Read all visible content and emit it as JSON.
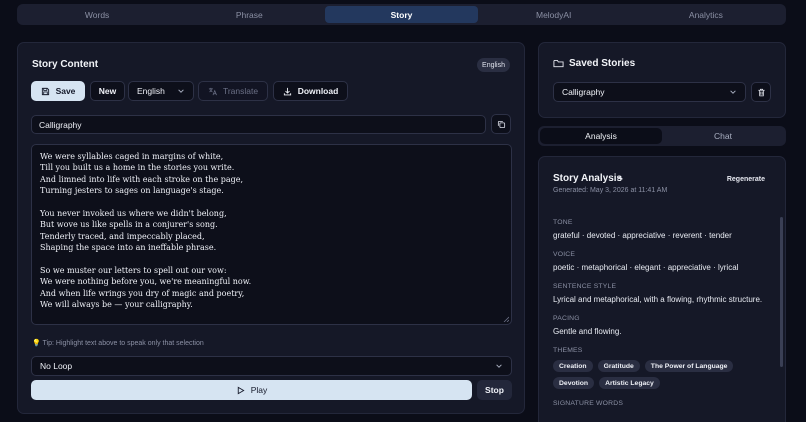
{
  "tabs": [
    {
      "label": "Words"
    },
    {
      "label": "Phrase"
    },
    {
      "label": "Story",
      "active": true
    },
    {
      "label": "MelodyAI"
    },
    {
      "label": "Analytics"
    }
  ],
  "left": {
    "title": "Story Content",
    "language_badge": "English",
    "toolbar": {
      "save_label": "Save",
      "new_label": "New",
      "language_value": "English",
      "translate_label": "Translate",
      "download_label": "Download"
    },
    "story_title_value": "Calligraphy",
    "story_stanzas": [
      [
        "We were syllables caged in margins of white,",
        "Till you built us a home in the stories you write.",
        "And limned into life with each stroke on the page,",
        "Turning jesters to sages on language's stage."
      ],
      [
        "You never invoked us where we didn't belong,",
        "But wove us like spells in a conjurer's song.",
        "Tenderly traced, and impeccably placed,",
        "Shaping the space into an ineffable phrase."
      ],
      [
        "So we muster our letters to spell out our vow:",
        "We were nothing before you, we're meaningful now.",
        "And when life wrings you dry of magic and poetry,",
        "We will always be — your calligraphy."
      ]
    ],
    "tip": "💡 Tip: Highlight text above to speak only that selection",
    "loop_value": "No Loop",
    "play_label": "Play",
    "stop_label": "Stop"
  },
  "saved": {
    "title": "Saved Stories",
    "selected": "Calligraphy"
  },
  "subtabs": [
    {
      "label": "Analysis",
      "active": true
    },
    {
      "label": "Chat"
    }
  ],
  "analysis": {
    "title": "Story Analysis",
    "generated": "Generated: May 3, 2026 at 11:41 AM",
    "regenerate_label": "Regenerate",
    "tone_label": "TONE",
    "tone_value": "grateful · devoted · appreciative · reverent · tender",
    "voice_label": "VOICE",
    "voice_value": "poetic · metaphorical · elegant · appreciative · lyrical",
    "sentence_label": "SENTENCE STYLE",
    "sentence_value": "Lyrical and metaphorical, with a flowing, rhythmic structure.",
    "pacing_label": "PACING",
    "pacing_value": "Gentle and flowing.",
    "themes_label": "THEMES",
    "themes": [
      "Creation",
      "Gratitude",
      "The Power of Language",
      "Devotion",
      "Artistic Legacy"
    ],
    "signature_label": "SIGNATURE WORDS"
  },
  "colors": {
    "background": "#0b0d18",
    "panel": "#151827",
    "active_tab": "#23385e",
    "light_button": "#d6e4f2"
  }
}
